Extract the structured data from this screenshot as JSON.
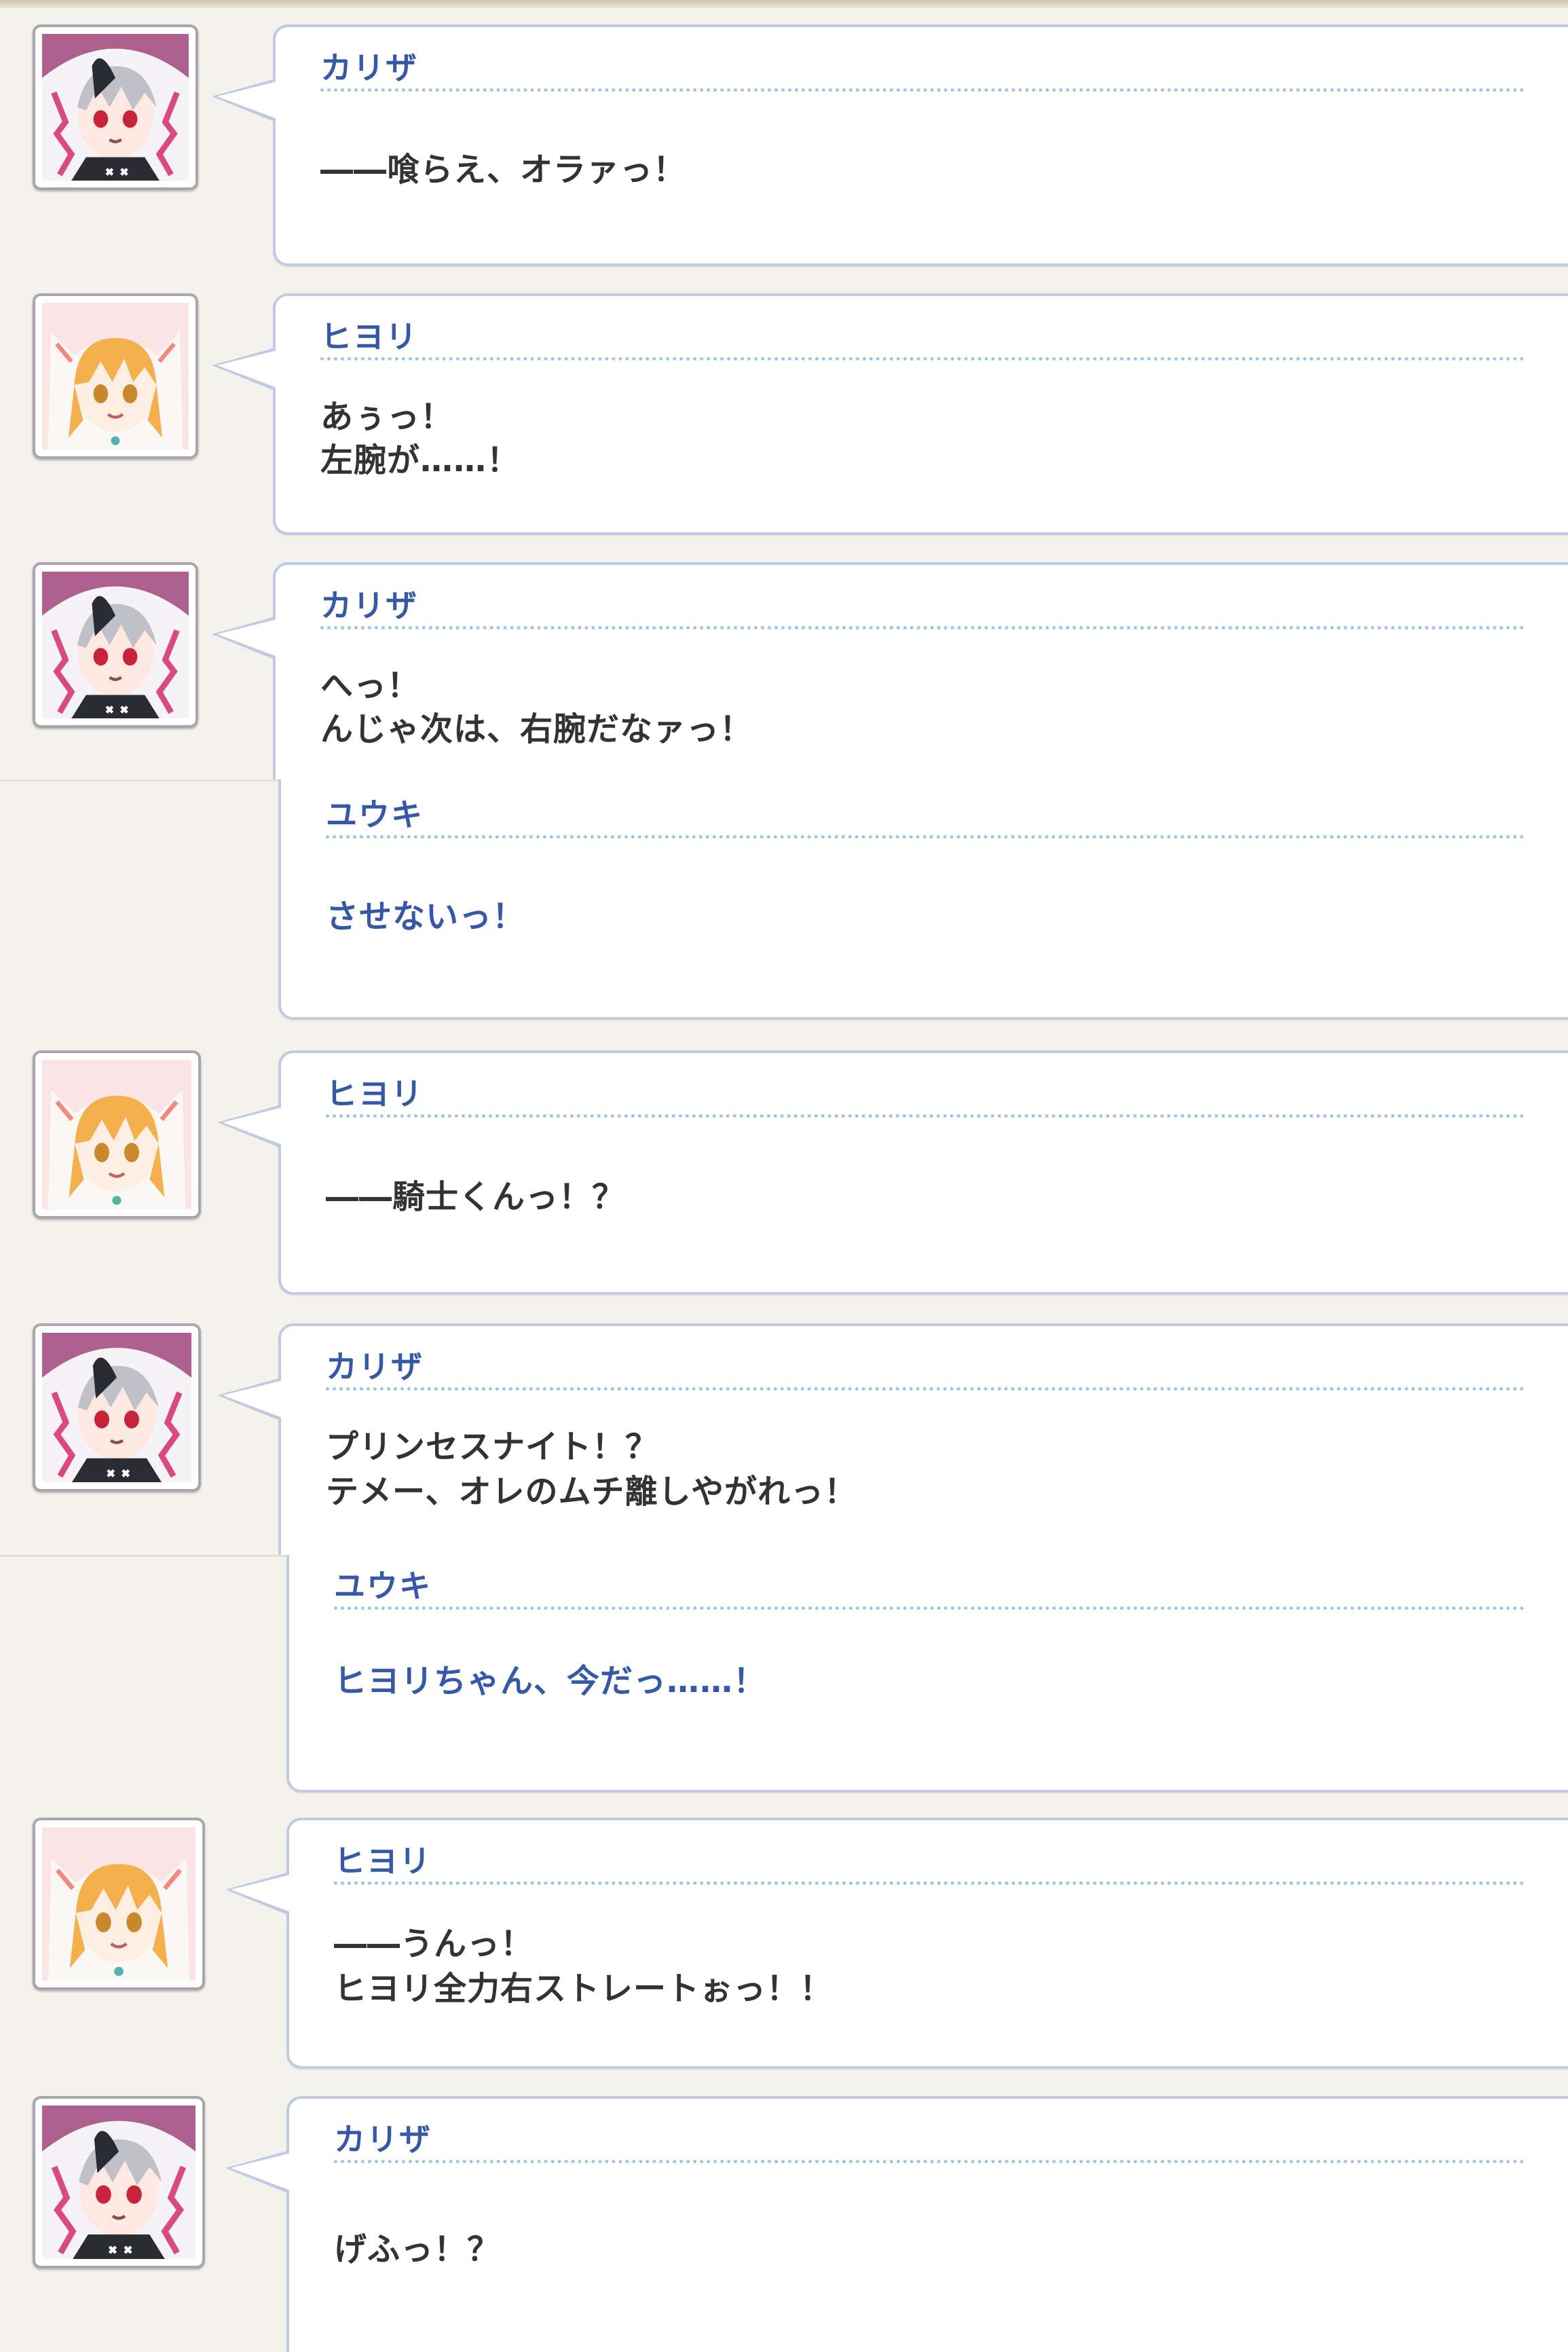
{
  "messages": [
    {
      "speaker": "カリザ",
      "lines": [
        "――喰らえ、オラァっ！"
      ]
    },
    {
      "speaker": "ヒヨリ",
      "lines": [
        "あぅっ！",
        "左腕が……！"
      ]
    },
    {
      "speaker": "カリザ",
      "lines": [
        "へっ！",
        "んじゃ次は、右腕だなァっ！"
      ]
    },
    {
      "speaker": "ユウキ",
      "lines": [
        "させないっ！"
      ]
    },
    {
      "speaker": "ヒヨリ",
      "lines": [
        "――騎士くんっ！？"
      ]
    },
    {
      "speaker": "カリザ",
      "lines": [
        "プリンセスナイト！？",
        "テメー、オレのムチ離しやがれっ！"
      ]
    },
    {
      "speaker": "ユウキ",
      "lines": [
        "ヒヨリちゃん、今だっ……！"
      ]
    },
    {
      "speaker": "ヒヨリ",
      "lines": [
        "――うんっ！",
        "ヒヨリ全力右ストレートぉっ！！"
      ]
    },
    {
      "speaker": "カリザ",
      "lines": [
        "げふっ！？"
      ]
    }
  ],
  "avatars": {
    "karyza": {
      "name": "karyza-portrait",
      "hood": "#f6f3f7",
      "hair": "#bfc0c8",
      "eyes": "#c7243a",
      "bg": "#ad5f8d",
      "accent": "#d94b7e"
    },
    "hiyori": {
      "name": "hiyori-portrait",
      "hood": "#fbf7f4",
      "hair": "#f3b04d",
      "eyes": "#c8892d",
      "bg": "#fbe4e4",
      "accent": "#f08a7e"
    }
  },
  "colors": {
    "speaker_name": "#3559a6",
    "protagonist_text": "#3559a6",
    "dialogue_text": "#333333",
    "bubble_border": "#bfcbe3",
    "divider": "#9fc4e6",
    "background": "#f4f2ec"
  }
}
